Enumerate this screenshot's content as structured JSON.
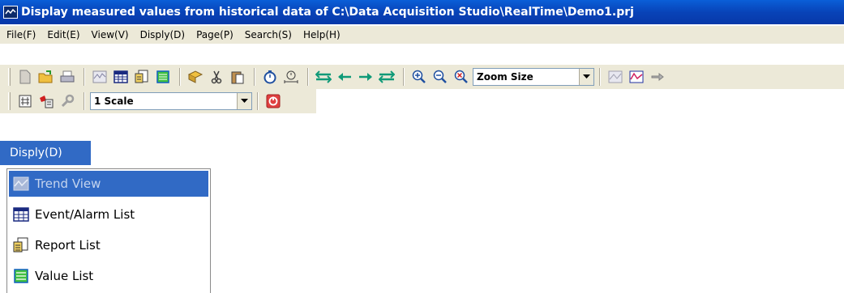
{
  "window": {
    "title": "Display measured values from historical data of C:\\Data Acquisition Studio\\RealTime\\Demo1.prj"
  },
  "menubar": {
    "items": [
      "File(F)",
      "Edit(E)",
      "View(V)",
      "Disply(D)",
      "Page(P)",
      "Search(S)",
      "Help(H)"
    ]
  },
  "toolbar1": {
    "zoom_combo": "Zoom Size",
    "icons": [
      "new-file-icon",
      "open-folder-icon",
      "print-icon",
      "trend-view-icon",
      "event-alarm-list-icon",
      "report-list-icon",
      "value-list-icon",
      "export-icon",
      "cut-icon",
      "paste-icon",
      "stopwatch-icon",
      "timer-icon",
      "expand-time-icon",
      "scroll-left-icon",
      "scroll-right-icon",
      "shrink-time-icon",
      "zoom-in-icon",
      "zoom-out-icon",
      "zoom-reset-icon",
      "trend-settings-icon",
      "chart-icon",
      "pointer-icon"
    ]
  },
  "toolbar2": {
    "scale_combo": "1 Scale",
    "icons": [
      "grid-icon",
      "cursor-icon",
      "wrench-icon",
      "stop-icon"
    ]
  },
  "dropdown": {
    "header": "Disply(D)",
    "items": [
      "Trend View",
      "Event/Alarm List",
      "Report List",
      "Value List"
    ],
    "selected": "Trend View"
  },
  "colors": {
    "titlebar": "#0843b8",
    "highlight": "#316ac5",
    "chrome": "#ece9d8",
    "arrow_green": "#109a78"
  }
}
